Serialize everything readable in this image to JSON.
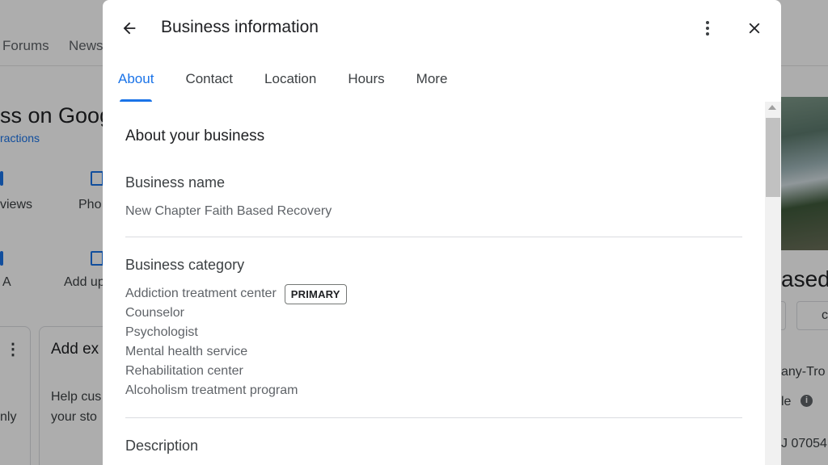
{
  "background": {
    "nav": [
      "Forums",
      "News"
    ],
    "title_fragment": "ss on Goog",
    "subtitle_fragment": "ractions",
    "left_items": [
      "views",
      "Pho",
      "A",
      "Add up"
    ],
    "card_title_fragment": "Add ex",
    "card_text_line1": "Help cus",
    "card_text_line2": "your sto",
    "card_left_text": "nly",
    "right_title_fragment": "ased",
    "right_btn_fragment": "c",
    "right_text1": "any-Tro",
    "right_text2": "le",
    "right_text3": "J 07054",
    "info_glyph": "i"
  },
  "dialog": {
    "title": "Business information",
    "tabs": [
      {
        "label": "About",
        "active": true
      },
      {
        "label": "Contact",
        "active": false
      },
      {
        "label": "Location",
        "active": false
      },
      {
        "label": "Hours",
        "active": false
      },
      {
        "label": "More",
        "active": false
      }
    ],
    "section_heading": "About your business",
    "business_name_label": "Business name",
    "business_name_value": "New Chapter Faith Based Recovery",
    "business_category_label": "Business category",
    "categories": [
      {
        "name": "Addiction treatment center",
        "badge": "PRIMARY"
      },
      {
        "name": "Counselor"
      },
      {
        "name": "Psychologist"
      },
      {
        "name": "Mental health service"
      },
      {
        "name": "Rehabilitation center"
      },
      {
        "name": "Alcoholism treatment program"
      }
    ],
    "description_label": "Description"
  },
  "colors": {
    "accent": "#1a73e8",
    "text_primary": "#202124",
    "text_secondary": "#5f6368",
    "divider": "#dadce0"
  },
  "icons": {
    "back": "arrow-left-icon",
    "more": "more-vert-icon",
    "close": "close-icon"
  }
}
